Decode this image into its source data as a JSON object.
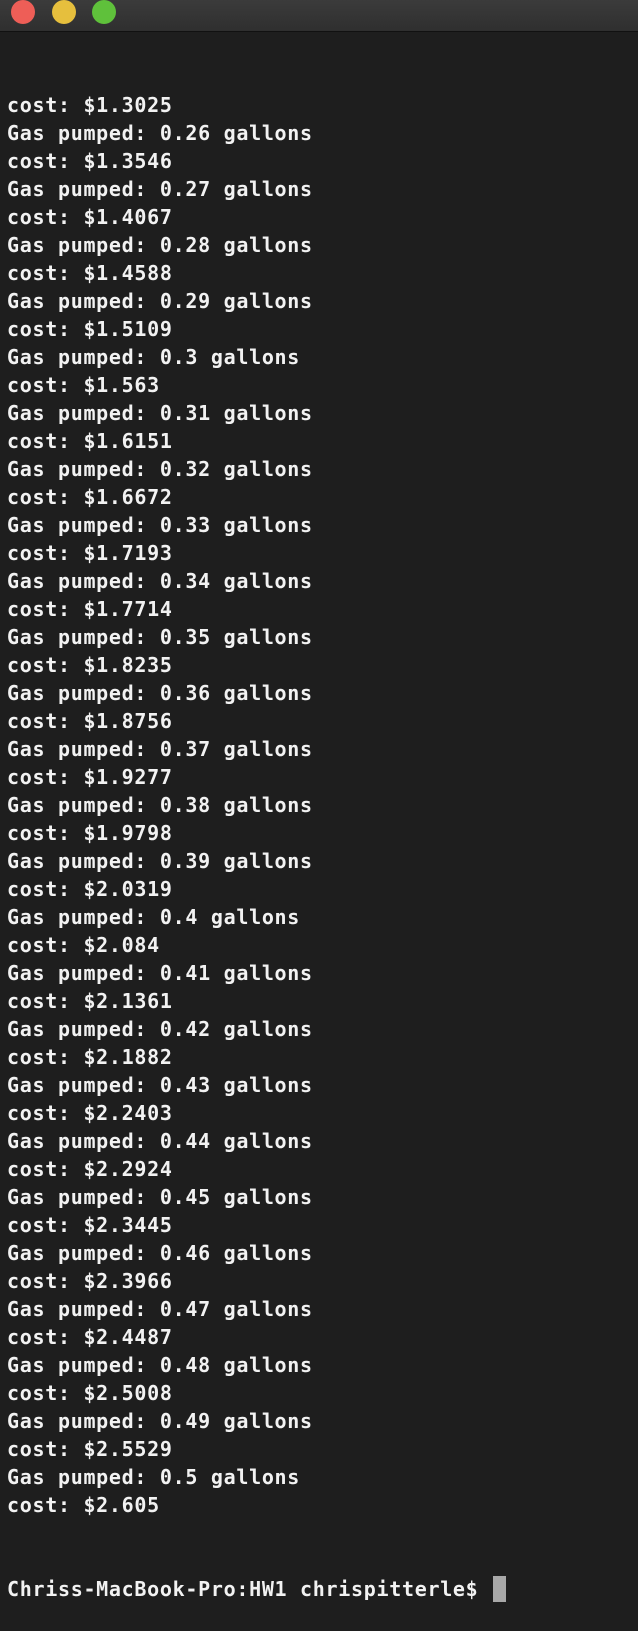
{
  "window": {
    "buttons": [
      "close",
      "minimize",
      "zoom"
    ]
  },
  "terminal": {
    "lines": [
      "cost: $1.3025",
      "Gas pumped: 0.26 gallons",
      "cost: $1.3546",
      "Gas pumped: 0.27 gallons",
      "cost: $1.4067",
      "Gas pumped: 0.28 gallons",
      "cost: $1.4588",
      "Gas pumped: 0.29 gallons",
      "cost: $1.5109",
      "Gas pumped: 0.3 gallons",
      "cost: $1.563",
      "Gas pumped: 0.31 gallons",
      "cost: $1.6151",
      "Gas pumped: 0.32 gallons",
      "cost: $1.6672",
      "Gas pumped: 0.33 gallons",
      "cost: $1.7193",
      "Gas pumped: 0.34 gallons",
      "cost: $1.7714",
      "Gas pumped: 0.35 gallons",
      "cost: $1.8235",
      "Gas pumped: 0.36 gallons",
      "cost: $1.8756",
      "Gas pumped: 0.37 gallons",
      "cost: $1.9277",
      "Gas pumped: 0.38 gallons",
      "cost: $1.9798",
      "Gas pumped: 0.39 gallons",
      "cost: $2.0319",
      "Gas pumped: 0.4 gallons",
      "cost: $2.084",
      "Gas pumped: 0.41 gallons",
      "cost: $2.1361",
      "Gas pumped: 0.42 gallons",
      "cost: $2.1882",
      "Gas pumped: 0.43 gallons",
      "cost: $2.2403",
      "Gas pumped: 0.44 gallons",
      "cost: $2.2924",
      "Gas pumped: 0.45 gallons",
      "cost: $2.3445",
      "Gas pumped: 0.46 gallons",
      "cost: $2.3966",
      "Gas pumped: 0.47 gallons",
      "cost: $2.4487",
      "Gas pumped: 0.48 gallons",
      "cost: $2.5008",
      "Gas pumped: 0.49 gallons",
      "cost: $2.5529",
      "Gas pumped: 0.5 gallons",
      "cost: $2.605"
    ],
    "prompt": "Chriss-MacBook-Pro:HW1 chrispitterle$ "
  },
  "colors": {
    "background": "#1e1e1e",
    "text": "#f2f2f2",
    "close": "#ee5e57",
    "minimize": "#e6bf3d",
    "zoom": "#5fc13b",
    "cursor": "#a8a8a8"
  }
}
